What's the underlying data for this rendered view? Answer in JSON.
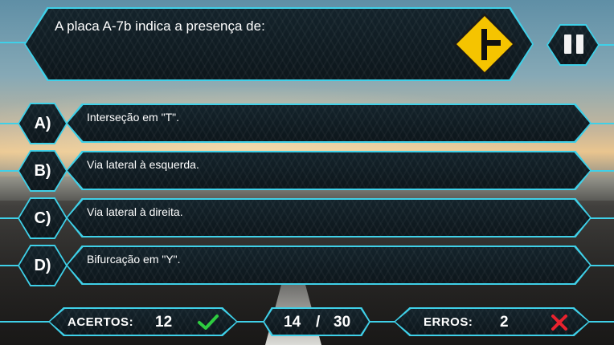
{
  "question": {
    "text": "A placa A-7b indica a presença de:",
    "sign_icon": "road-sign-side-road-right-icon"
  },
  "pause_button": {
    "icon": "pause-icon"
  },
  "answers": [
    {
      "letter": "A)",
      "text": "Interseção em \"T\"."
    },
    {
      "letter": "B)",
      "text": "Via lateral à esquerda."
    },
    {
      "letter": "C)",
      "text": "Via lateral à direita."
    },
    {
      "letter": "D)",
      "text": "Bifurcação em \"Y\"."
    }
  ],
  "score": {
    "correct_label": "ACERTOS:",
    "correct_value": "12",
    "correct_icon": "check-icon",
    "progress_current": "14",
    "progress_separator": "/",
    "progress_total": "30",
    "errors_label": "ERROS:",
    "errors_value": "2",
    "errors_icon": "x-icon"
  },
  "colors": {
    "accent": "#3fd0e8",
    "panel": "#111d23",
    "correct": "#2ecc40",
    "error": "#e8222e",
    "sign_yellow": "#f5c400"
  }
}
